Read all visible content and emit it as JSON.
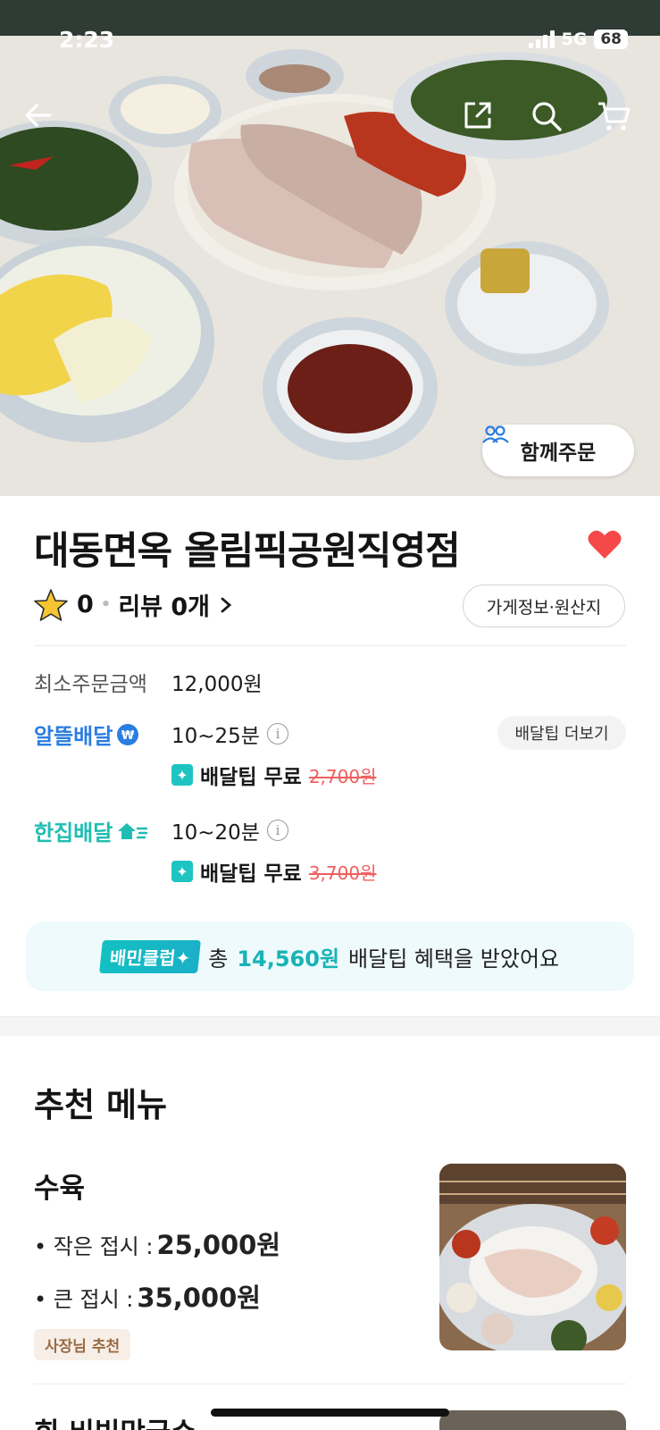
{
  "status_bar": {
    "time": "2:23",
    "network": "5G",
    "battery": "68"
  },
  "hero": {
    "together_order_label": "함께주문"
  },
  "store": {
    "name": "대동면옥 올림픽공원직영점",
    "rating": "0",
    "review_label": "리뷰 0개",
    "info_button": "가게정보·원산지",
    "min_order_label": "최소주문금액",
    "min_order_value": "12,000원"
  },
  "delivery": {
    "saver": {
      "label": "알뜰배달",
      "time": "10~25분",
      "tip_free": "배달팁 무료",
      "tip_original": "2,700원"
    },
    "single": {
      "label": "한집배달",
      "time": "10~20분",
      "tip_free": "배달팁 무료",
      "tip_original": "3,700원"
    },
    "more_tip_button": "배달팁 더보기"
  },
  "club_banner": {
    "badge": "배민클럽",
    "prefix": "총",
    "amount": "14,560원",
    "suffix": "배달팁 혜택을 받았어요"
  },
  "recommended": {
    "title": "추천 메뉴",
    "items": [
      {
        "name": "수육",
        "options": [
          {
            "label": "• 작은 접시 :",
            "price": "25,000원"
          },
          {
            "label": "• 큰 접시 :",
            "price": "35,000원"
          }
        ],
        "badge": "사장님 추천"
      },
      {
        "name": "회 비빔막국수"
      }
    ]
  },
  "colors": {
    "accent_teal": "#1ec4c2",
    "brand_blue": "#2a7de1",
    "heart_red": "#f54848",
    "strike_red": "#f05f5f"
  }
}
